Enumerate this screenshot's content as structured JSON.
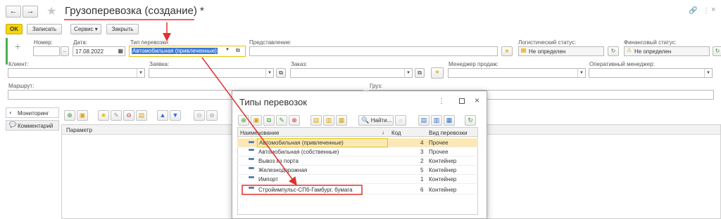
{
  "window": {
    "title": "Грузоперевозка (создание) *",
    "nav_back": "←",
    "nav_forward": "→"
  },
  "toolbar": {
    "ok": "OK",
    "save": "Записать",
    "service": "Сервис",
    "close": "Закрыть"
  },
  "form": {
    "number_label": "Номер:",
    "number_value": "",
    "date_label": "Дата:",
    "date_value": "17.08.2022",
    "type_label": "Тип перевозки:",
    "type_value": "Автомобильная (привлеченные)",
    "representation_label": "Представление:",
    "log_status_label": "Логистический статус:",
    "log_status_value": "Не определен",
    "fin_status_label": "Финансовый статус:",
    "fin_status_value": "Не определен",
    "client_label": "Клиент:",
    "request_label": "Заявка:",
    "order_label": "Заказ:",
    "sales_manager_label": "Менеджер продаж:",
    "op_manager_label": "Оперативный менеджер:",
    "route_label": "Маршрут:",
    "cargo_label": "Груз:"
  },
  "side_tabs": [
    {
      "label": "Мониторинг"
    },
    {
      "label": "Комментарий"
    }
  ],
  "param_table": {
    "header": "Параметр"
  },
  "dialog": {
    "title": "Типы перевозок",
    "find_label": "Найти...",
    "columns": {
      "name": "Наименование",
      "sort": "↓",
      "code": "Код",
      "kind": "Вид перевозки"
    },
    "rows": [
      {
        "name": "Автомобильная (привлеченные)",
        "code": "4",
        "kind": "Прочее"
      },
      {
        "name": "Автомобильная (собственные)",
        "code": "3",
        "kind": "Прочее"
      },
      {
        "name": "Вывоз из порта",
        "code": "2",
        "kind": "Контейнер"
      },
      {
        "name": "Железнодорожная",
        "code": "5",
        "kind": "Контейнер"
      },
      {
        "name": "Импорт",
        "code": "1",
        "kind": "Контейнер"
      },
      {
        "name": "Стройимпульс-СПб-Гамбург, бумага",
        "code": "6",
        "kind": "Контейнер"
      }
    ]
  },
  "colors": {
    "accent_yellow": "#f5d50c",
    "annotation_red": "#e0302e",
    "selected_row": "#fbe9b5"
  }
}
